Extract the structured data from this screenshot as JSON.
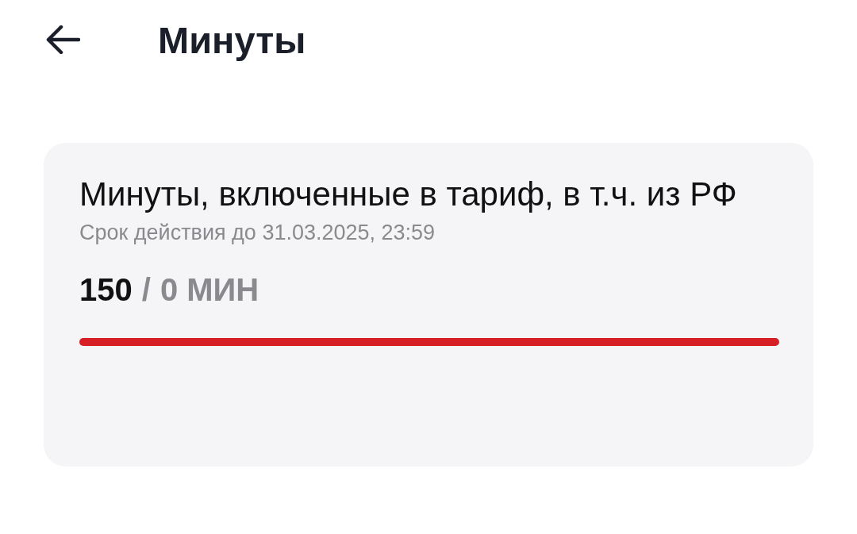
{
  "header": {
    "title": "Минуты"
  },
  "package": {
    "name": "Минуты, включенные в тариф, в т.ч. из РФ",
    "validity": "Срок действия до 31.03.2025, 23:59",
    "amount": "150",
    "separator": "/",
    "remaining": "0 МИН",
    "level": 1
  }
}
